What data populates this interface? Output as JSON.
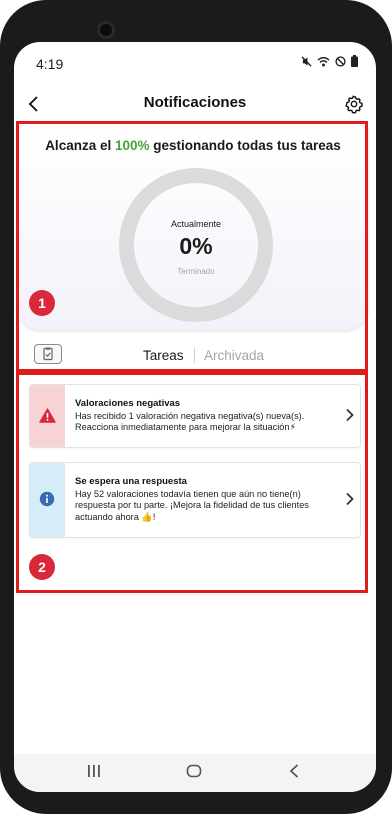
{
  "status_bar": {
    "time": "4:19"
  },
  "header": {
    "title": "Notificaciones"
  },
  "progress": {
    "headline_prefix": "Alcanza el ",
    "headline_percent": "100%",
    "headline_suffix": " gestionando todas tus tareas",
    "ring_label_top": "Actualmente",
    "ring_value": "0%",
    "ring_label_bottom": "Terminado",
    "completion_fraction": 0
  },
  "tabs": [
    {
      "label": "Tareas",
      "active": true
    },
    {
      "label": "Archivada",
      "active": false
    }
  ],
  "notifications": [
    {
      "title": "Valoraciones negativas",
      "body": "Has recibido 1 valoración negativa negativa(s) nueva(s). Reacciona inmediatamente para mejorar la situación⚡",
      "icon": "warning-icon",
      "color": "#f8d3d6",
      "icon_color": "#d9283a"
    },
    {
      "title": "Se espera una respuesta",
      "body": "Hay 52 valoraciones todavía tienen que aún no tiene(n) respuesta por tu parte. ¡Mejora la fidelidad de tus clientes actuando ahora 👍!",
      "icon": "info-icon",
      "color": "#d7ecf9",
      "icon_color": "#3a6bb0"
    }
  ],
  "annotations": {
    "badge_1": "1",
    "badge_2": "2",
    "highlight_color": "#e01b1b"
  },
  "colors": {
    "accent_green": "#46a33a",
    "badge_red": "#d9283a"
  }
}
